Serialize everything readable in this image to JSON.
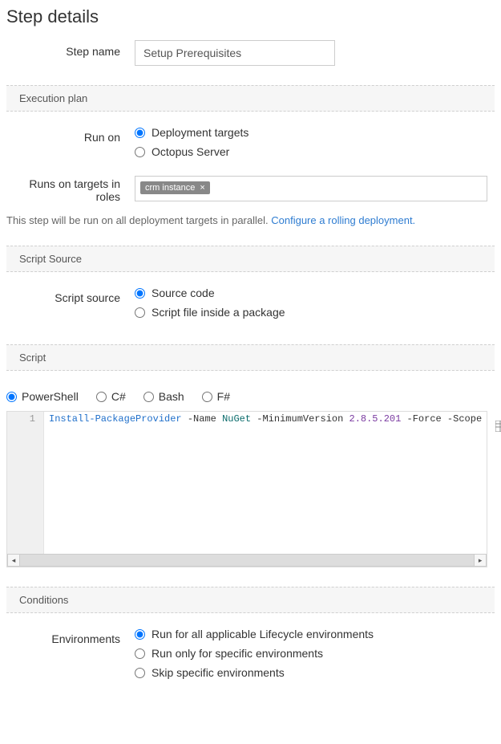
{
  "header": {
    "title": "Step details"
  },
  "step_name": {
    "label": "Step name",
    "value": "Setup Prerequisites"
  },
  "execution_plan": {
    "section_title": "Execution plan",
    "run_on_label": "Run on",
    "run_on_options": {
      "deployment_targets": "Deployment targets",
      "octopus_server": "Octopus Server"
    },
    "run_on_selected": "deployment_targets",
    "runs_on_targets_label": "Runs on targets in roles",
    "role_tag": "crm instance",
    "help_text": "This step will be run on all deployment targets in parallel. ",
    "help_link": "Configure a rolling deployment."
  },
  "script_source": {
    "section_title": "Script Source",
    "label": "Script source",
    "options": {
      "source_code": "Source code",
      "file_package": "Script file inside a package"
    },
    "selected": "source_code"
  },
  "script": {
    "section_title": "Script",
    "languages": {
      "powershell": "PowerShell",
      "csharp": "C#",
      "bash": "Bash",
      "fsharp": "F#"
    },
    "selected_language": "powershell",
    "line_number": "1",
    "code_tokens": {
      "cmd": "Install-PackageProvider",
      "dash_name": " -Name ",
      "name_val": "NuGet",
      "dash_min": " -MinimumVersion ",
      "version": "2.8.5.201",
      "dash_force": " -Force",
      "dash_scope": " -Scope "
    }
  },
  "conditions": {
    "section_title": "Conditions",
    "environments_label": "Environments",
    "options": {
      "all": "Run for all applicable Lifecycle environments",
      "only": "Run only for specific environments",
      "skip": "Skip specific environments"
    },
    "selected": "all"
  }
}
